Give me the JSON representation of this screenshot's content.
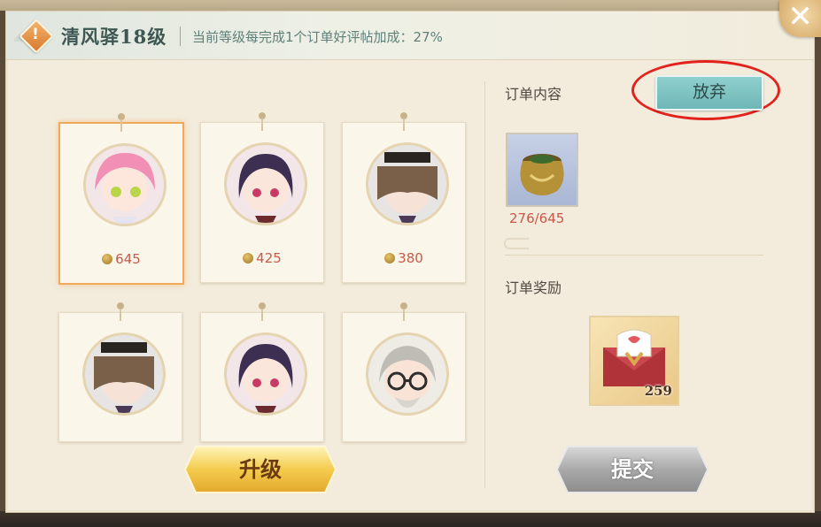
{
  "header": {
    "title": "清风驿18级",
    "description": "当前等级每完成1个订单好评帖加成：27%"
  },
  "close_icon": "close-icon",
  "cards": [
    {
      "name": "pink-haired-girl",
      "price": "645",
      "selected": true
    },
    {
      "name": "dark-haired-girl",
      "price": "425",
      "selected": false
    },
    {
      "name": "hat-man",
      "price": "380",
      "selected": false
    },
    {
      "name": "hat-man-2",
      "price": "",
      "selected": false
    },
    {
      "name": "dark-haired-girl-2",
      "price": "",
      "selected": false
    },
    {
      "name": "old-man-glasses",
      "price": "",
      "selected": false
    }
  ],
  "buttons": {
    "upgrade": "升级",
    "submit": "提交",
    "abandon": "放弃"
  },
  "order": {
    "content_label": "订单内容",
    "item_progress": "276/645",
    "reward_label": "订单奖励",
    "reward_count": "259"
  }
}
